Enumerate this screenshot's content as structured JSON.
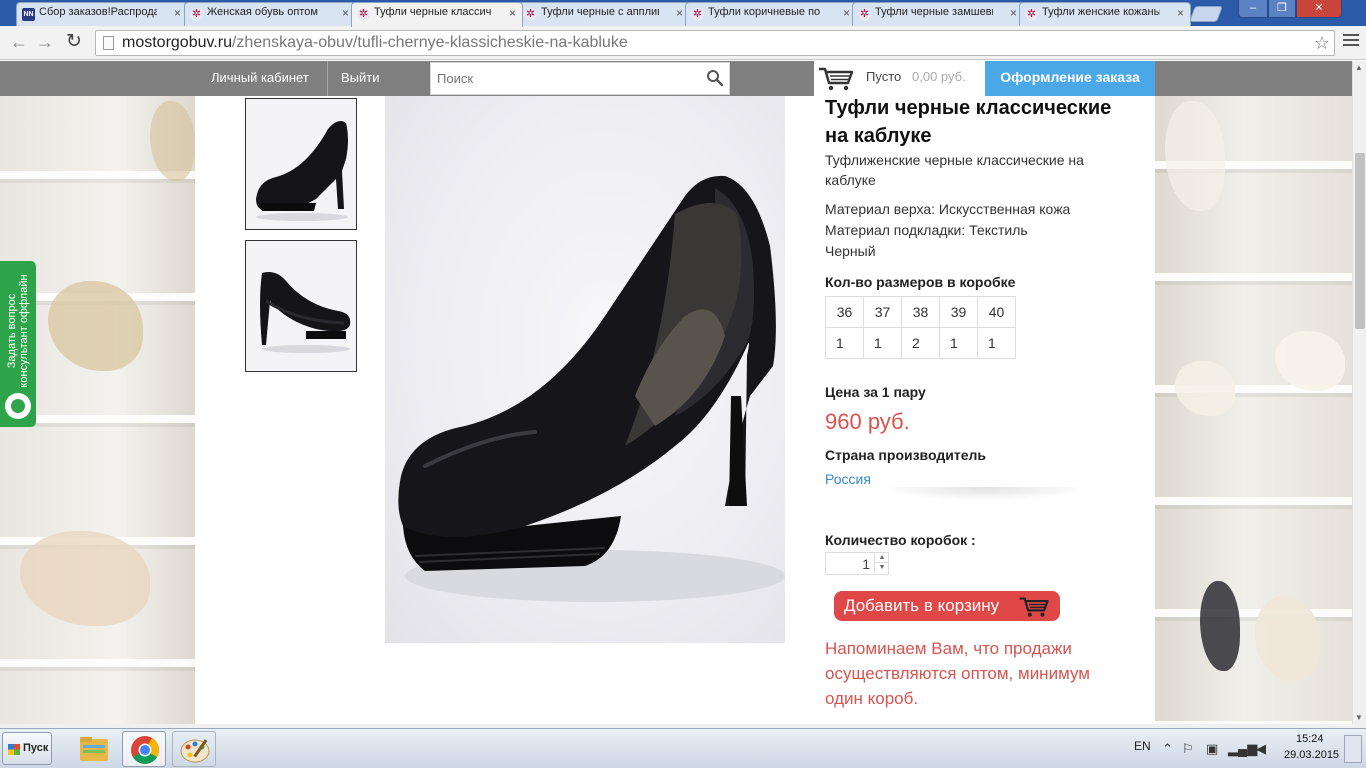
{
  "browser": {
    "tabs": [
      {
        "title": "Сбор заказов!Распродажа",
        "favicon": "nn-logo-icon"
      },
      {
        "title": "Женская обувь оптом",
        "favicon": "site-flower-icon"
      },
      {
        "title": "Туфли черные классические",
        "favicon": "site-flower-icon",
        "active": true
      },
      {
        "title": "Туфли черные с аппликацией",
        "favicon": "site-flower-icon"
      },
      {
        "title": "Туфли коричневые по",
        "favicon": "site-flower-icon"
      },
      {
        "title": "Туфли черные замшевые",
        "favicon": "site-flower-icon"
      },
      {
        "title": "Туфли женские кожаные",
        "favicon": "site-flower-icon"
      }
    ],
    "favicon_nn_text": "NN",
    "url_domain": "mostorgobuv.ru",
    "url_path": "/zhenskaya-obuv/tufli-chernye-klassicheskie-na-kabluke"
  },
  "header": {
    "account_link": "Личный кабинет",
    "logout_link": "Выйти",
    "search_placeholder": "Поиск",
    "cart_status": "Пусто",
    "cart_total": "0,00 руб.",
    "checkout_label": "Оформление заказа"
  },
  "consultant": {
    "line1": "Задать вопрос",
    "line2": "консультант оффлайн"
  },
  "product": {
    "title": "Туфли черные классические на каблуке",
    "subtitle": "Туфлиженские черные классические на каблуке",
    "specs": {
      "upper": "Материал верха: Искусственная кожа",
      "lining": "Материал подкладки: Текстиль",
      "color": "Черный"
    },
    "sizes_title": "Кол-во размеров в коробке",
    "sizes": [
      "36",
      "37",
      "38",
      "39",
      "40"
    ],
    "counts": [
      "1",
      "1",
      "2",
      "1",
      "1"
    ],
    "price_label": "Цена за 1 пару",
    "price": "960 руб.",
    "country_label": "Страна производитель",
    "country": "Россия",
    "qty_label": "Количество коробок :",
    "qty_value": "1",
    "add_to_cart_label": "Добавить в корзину",
    "notice": "Напоминаем Вам, что продажи осуществляются оптом, минимум один короб."
  },
  "taskbar": {
    "start_label": "Пуск",
    "language": "EN",
    "time": "15:24",
    "date": "29.03.2015"
  },
  "colors": {
    "accent_price": "#d9534f",
    "checkout_blue": "#4aa8e8",
    "add_to_cart_red": "#e04848",
    "consultant_green": "#2ea44a",
    "header_gray": "#808080"
  }
}
